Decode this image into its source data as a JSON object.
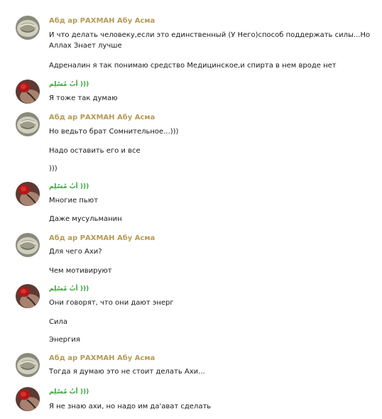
{
  "colors": {
    "author_gold": "#b69a55",
    "author_green": "#3aa63d",
    "text": "#1a1a1a",
    "background": "#ffffff"
  },
  "groups": [
    {
      "author": "Абд ар РАХМАН Абу Асма",
      "author_style": "gold",
      "avatar_icon": "cap-avatar-icon",
      "messages": [
        "И что делать человеку,если это единственный (У Него)способ поддержать силы...Но Аллах Знает лучше",
        "Адреналин я так понимаю средство Медицинское,и спирта в нем вроде нет"
      ]
    },
    {
      "author": "أبُ مُسْلِم )))",
      "author_style": "green",
      "avatar_icon": "rose-avatar-icon",
      "messages": [
        "Я тоже так думаю"
      ]
    },
    {
      "author": "Абд ар РАХМАН Абу Асма",
      "author_style": "gold",
      "avatar_icon": "cap-avatar-icon",
      "messages": [
        "Но ведьто брат Сомнительное...)))",
        "Надо оставить его и все",
        ")))"
      ]
    },
    {
      "author": "أبُ مُسْلِم )))",
      "author_style": "green",
      "avatar_icon": "rose-avatar-icon",
      "messages": [
        "Многие пьют",
        "Даже мусульманин"
      ]
    },
    {
      "author": "Абд ар РАХМАН Абу Асма",
      "author_style": "gold",
      "avatar_icon": "cap-avatar-icon",
      "messages": [
        "Для чего Ахи?",
        "Чем мотивируют"
      ]
    },
    {
      "author": "أبُ مُسْلِم )))",
      "author_style": "green",
      "avatar_icon": "rose-avatar-icon",
      "messages": [
        "Они говорят, что они дают энерг",
        "Сила",
        "Энергия"
      ]
    },
    {
      "author": "Абд ар РАХМАН Абу Асма",
      "author_style": "gold",
      "avatar_icon": "cap-avatar-icon",
      "messages": [
        "Тогда я думаю это не стоит делать Ахи..."
      ]
    },
    {
      "author": "أبُ مُسْلِم )))",
      "author_style": "green",
      "avatar_icon": "rose-avatar-icon",
      "messages": [
        "Я не знаю ахи, но надо им да'ават сделать"
      ]
    }
  ]
}
